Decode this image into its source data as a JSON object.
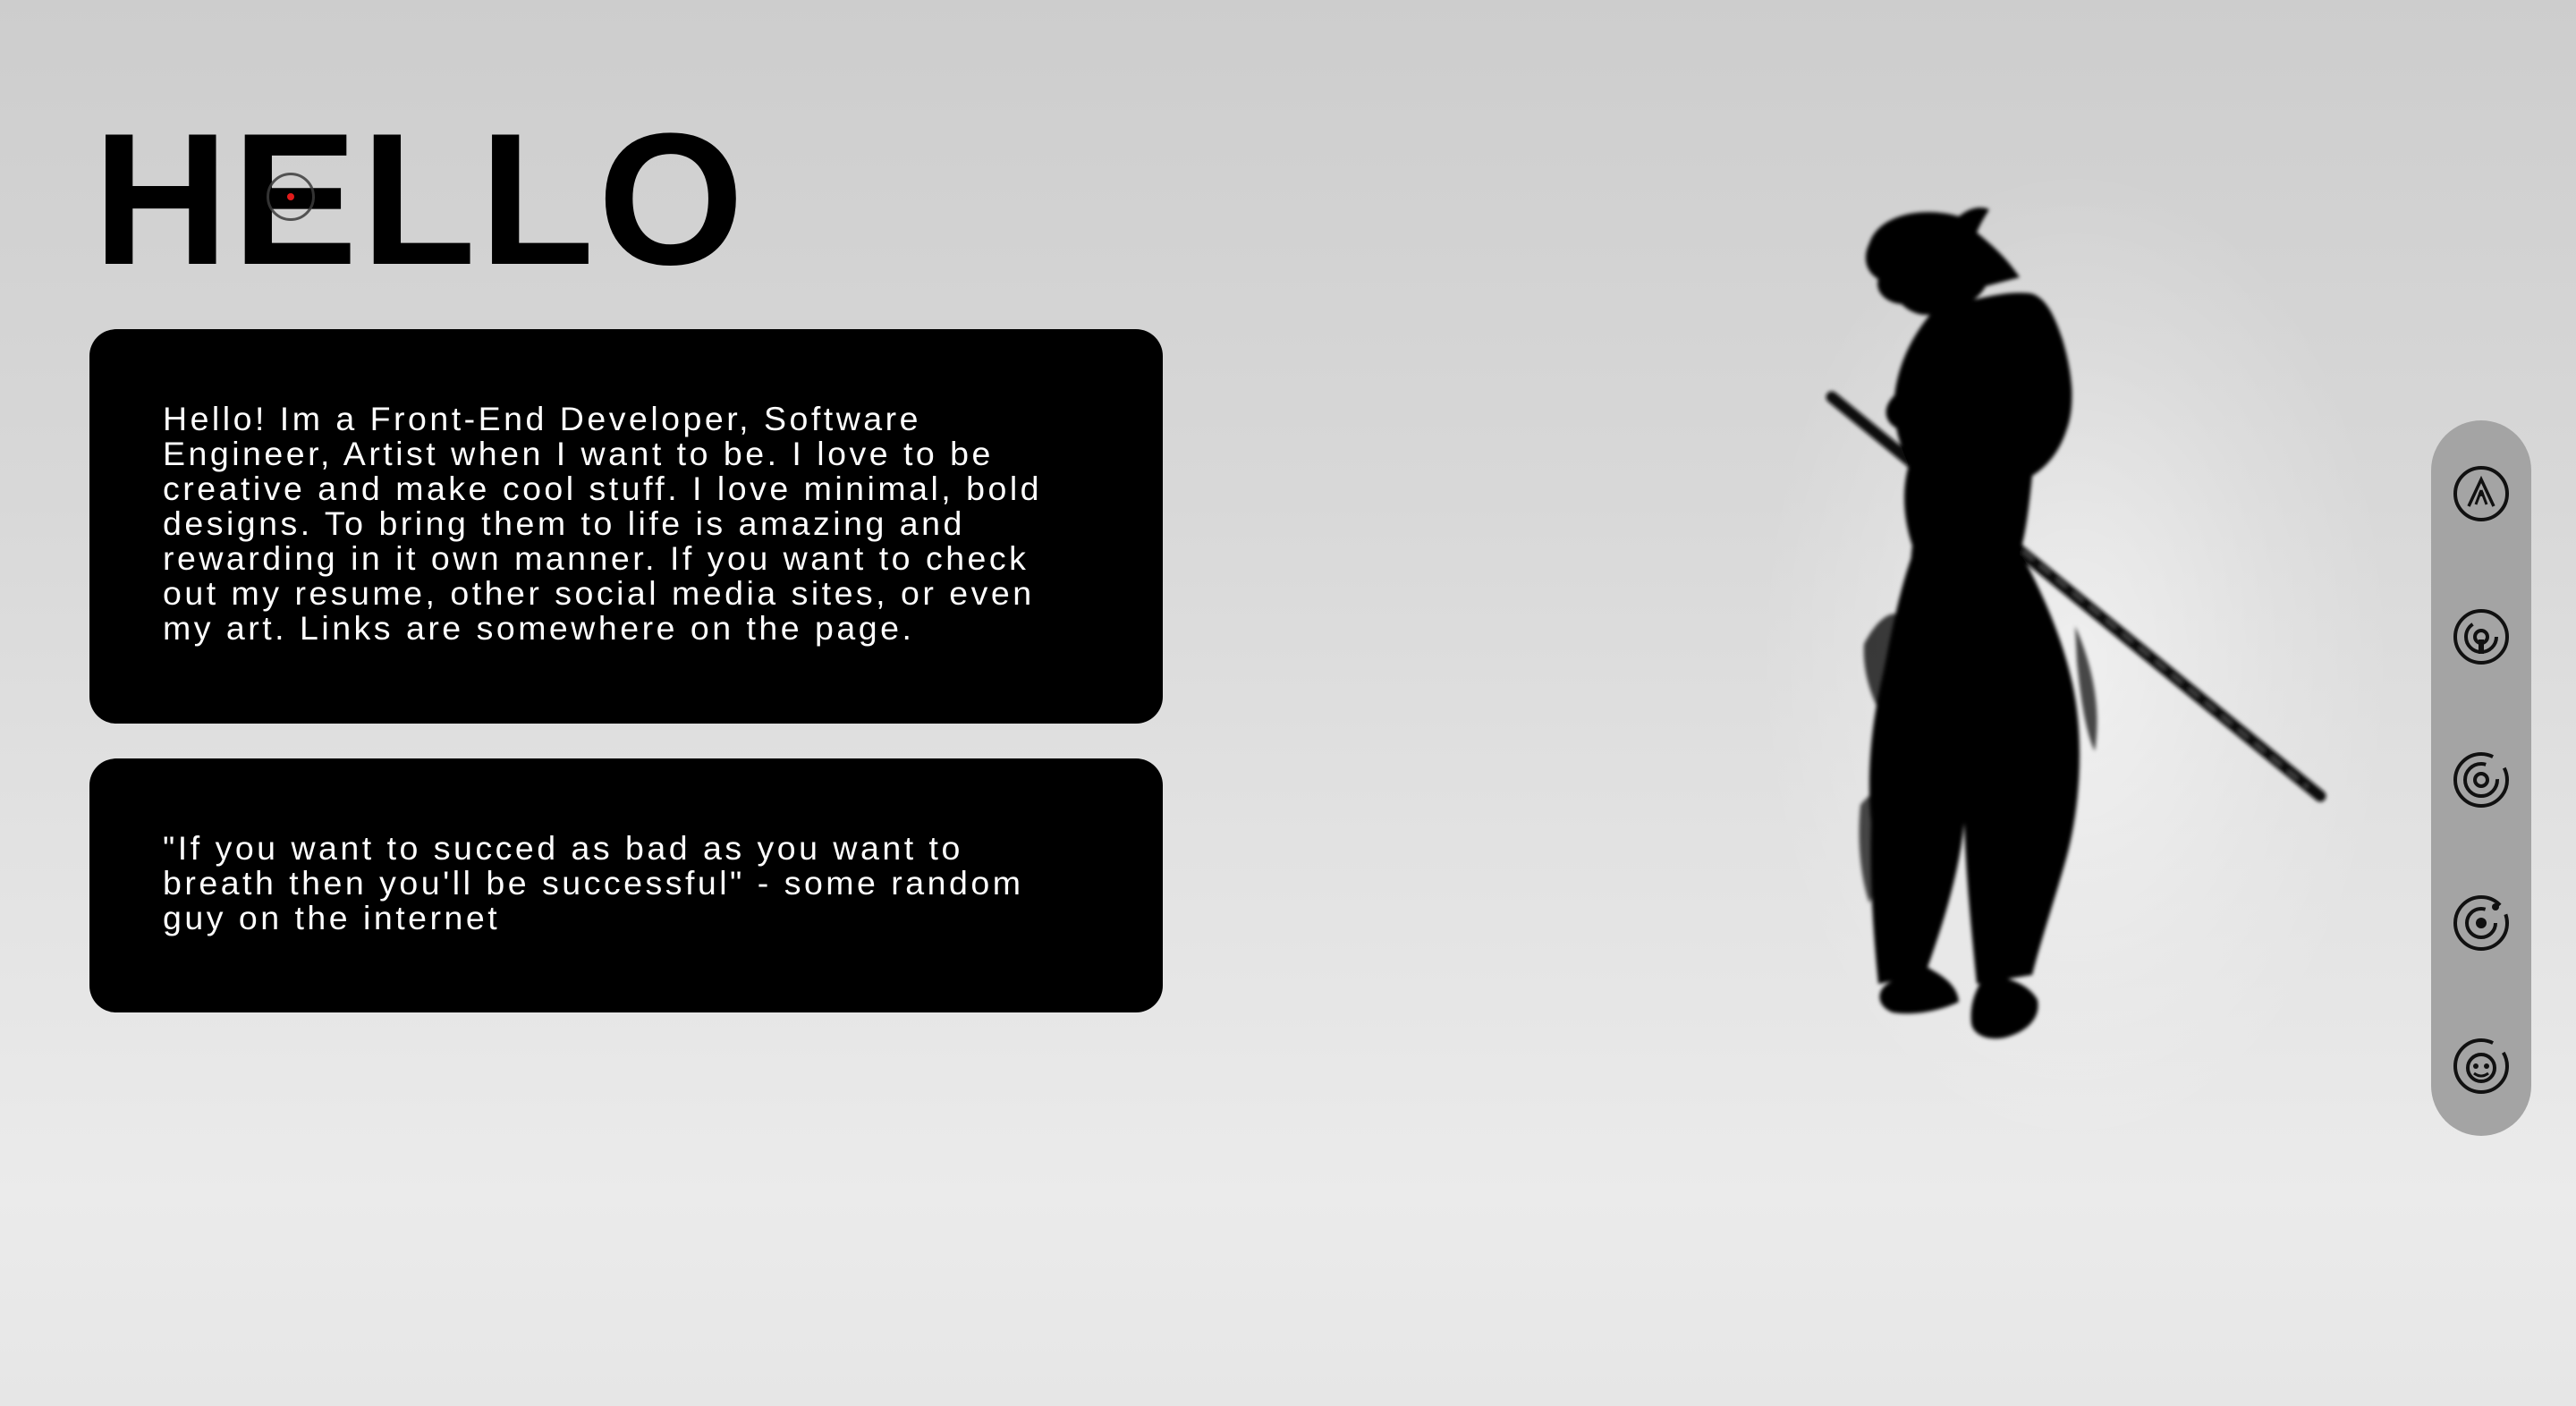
{
  "hero": {
    "title": "HELLO"
  },
  "about": {
    "text": "Hello! Im a Front-End Developer, Software\nEngineer, Artist when I want to be. I love to be\ncreative and make cool stuff. I love minimal, bold\ndesigns. To bring them to life is amazing and\nrewarding in it own manner. If you want to check\nout my resume, other social media sites, or even\nmy art. Links are somewhere on the page."
  },
  "quote": {
    "text": "\"If you want to succed as bad as you want to\nbreath then you'll be successful\" - some random\nguy on the internet"
  },
  "illustration": {
    "icon": "samurai-silhouette"
  },
  "social_links": [
    {
      "icon": "social-link-1-icon"
    },
    {
      "icon": "social-link-2-icon"
    },
    {
      "icon": "social-link-3-icon"
    },
    {
      "icon": "social-link-4-icon"
    },
    {
      "icon": "social-link-5-icon"
    }
  ],
  "colors": {
    "background": "#d8d8d8",
    "card": "#000000",
    "card_text": "#ffffff",
    "rail": "#a4a4a4",
    "cursor_dot": "#e21b1b"
  }
}
